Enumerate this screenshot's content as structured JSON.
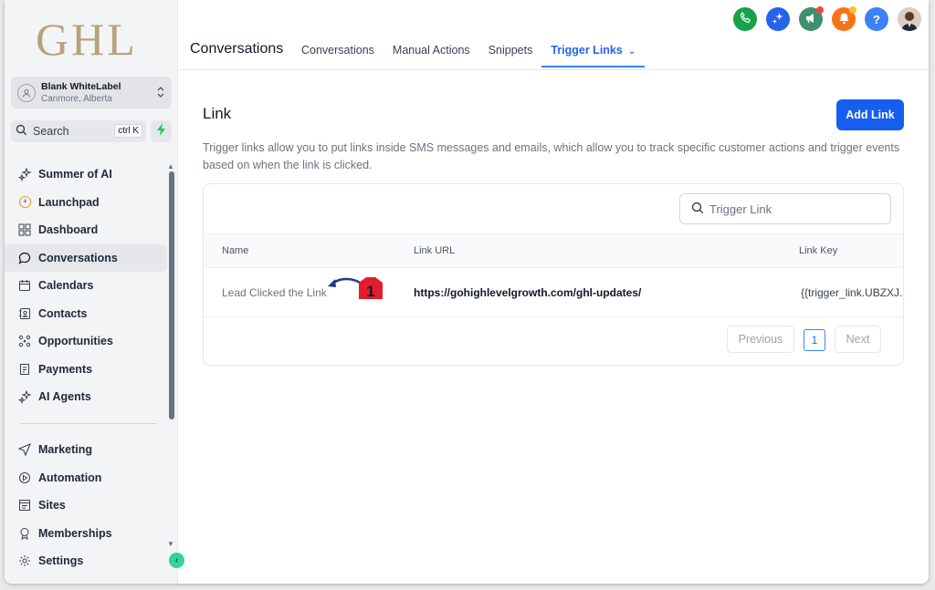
{
  "brand": {
    "logo_text": "GHL",
    "accent": "#155eef"
  },
  "account": {
    "name": "Blank WhiteLabel",
    "location": "Canmore, Alberta"
  },
  "search": {
    "label": "Search",
    "shortcut": "ctrl K"
  },
  "sidebar": {
    "items": [
      {
        "label": "Summer of AI",
        "icon": "sparkle-icon"
      },
      {
        "label": "Launchpad",
        "icon": "rocket-icon"
      },
      {
        "label": "Dashboard",
        "icon": "grid-icon"
      },
      {
        "label": "Conversations",
        "icon": "chat-icon"
      },
      {
        "label": "Calendars",
        "icon": "calendar-icon"
      },
      {
        "label": "Contacts",
        "icon": "contacts-icon"
      },
      {
        "label": "Opportunities",
        "icon": "opportunities-icon"
      },
      {
        "label": "Payments",
        "icon": "payments-icon"
      },
      {
        "label": "AI Agents",
        "icon": "sparkle-icon"
      }
    ],
    "items2": [
      {
        "label": "Marketing",
        "icon": "send-icon"
      },
      {
        "label": "Automation",
        "icon": "automation-icon"
      },
      {
        "label": "Sites",
        "icon": "sites-icon"
      },
      {
        "label": "Memberships",
        "icon": "award-icon"
      },
      {
        "label": "Settings",
        "icon": "gear-icon"
      }
    ]
  },
  "header": {
    "title": "Conversations",
    "tabs": [
      {
        "label": "Conversations"
      },
      {
        "label": "Manual Actions"
      },
      {
        "label": "Snippets"
      },
      {
        "label": "Trigger Links"
      }
    ]
  },
  "top_icons": {
    "help_label": "?",
    "colors": {
      "phone": "#16a34a",
      "ai": "#2563eb",
      "announce": "#3f8f6f",
      "bell": "#f97316",
      "help": "#3b82f6"
    }
  },
  "main": {
    "title": "Link",
    "add_button": "Add Link",
    "description": "Trigger links allow you to put links inside SMS messages and emails, which allow you to track specific customer actions and trigger events based on when the link is clicked.",
    "table_search_placeholder": "Trigger Link",
    "columns": [
      "Name",
      "Link URL",
      "Link Key"
    ],
    "rows": [
      {
        "name": "Lead Clicked the Link",
        "url": "https://gohighlevelgrowth.com/ghl-updates/",
        "key": "{{trigger_link.UBZXJ..."
      }
    ],
    "marker_number": "1",
    "pager": {
      "previous": "Previous",
      "page": "1",
      "next": "Next"
    }
  }
}
